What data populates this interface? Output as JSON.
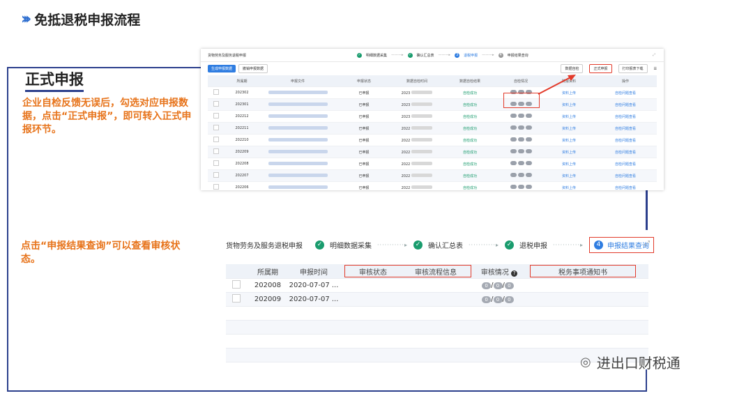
{
  "header": {
    "title": "免抵退税申报流程"
  },
  "section": {
    "title": "正式申报"
  },
  "notes": {
    "note1": "企业自检反馈无误后，勾选对应申报数据，点击“正式申报”，即可转入正式申报环节。",
    "note2": "点击“申报结果查询”可以查看审核状态。"
  },
  "shot1": {
    "crumb": "货物劳务及服务退税申报",
    "steps": [
      "明细数据采集",
      "确认汇总表",
      "退税申报",
      "申报结果查询"
    ],
    "toolbar": {
      "generate": "生成申报数据",
      "withdraw": "撤销申报数据",
      "selfcheck": "数据自检",
      "formal": "正式申报",
      "print": "打印报表下载"
    },
    "headers": [
      "所属期",
      "申报文件",
      "申报状态",
      "数据自检时间",
      "数据自检结果",
      "自检情况",
      "随报资料",
      "操作"
    ],
    "rows": [
      {
        "period": "202302",
        "status": "已申报",
        "time": "2023",
        "result": "自检成功",
        "upload": "资料上传",
        "op": "自检问题查看"
      },
      {
        "period": "202301",
        "status": "已申报",
        "time": "2023",
        "result": "自检成功",
        "upload": "资料上传",
        "op": "自检问题查看"
      },
      {
        "period": "202212",
        "status": "已申报",
        "time": "2023",
        "result": "自检成功",
        "upload": "资料上传",
        "op": "自检问题查看"
      },
      {
        "period": "202211",
        "status": "已申报",
        "time": "2022",
        "result": "自检成功",
        "upload": "资料上传",
        "op": "自检问题查看"
      },
      {
        "period": "202210",
        "status": "已申报",
        "time": "2022",
        "result": "自检成功",
        "upload": "资料上传",
        "op": "自检问题查看"
      },
      {
        "period": "202209",
        "status": "已申报",
        "time": "2022",
        "result": "自检成功",
        "upload": "资料上传",
        "op": "自检问题查看"
      },
      {
        "period": "202208",
        "status": "已申报",
        "time": "2022",
        "result": "自检成功",
        "upload": "资料上传",
        "op": "自检问题查看"
      },
      {
        "period": "202207",
        "status": "已申报",
        "time": "2022",
        "result": "自检成功",
        "upload": "资料上传",
        "op": "自检问题查看"
      },
      {
        "period": "202206",
        "status": "已申报",
        "time": "2022",
        "result": "自检成功",
        "upload": "资料上传",
        "op": "自检问题查看"
      }
    ]
  },
  "shot2": {
    "crumb": "货物劳务及服务退税申报",
    "steps": [
      "明细数据采集",
      "确认汇总表",
      "退税申报",
      "申报结果查询"
    ],
    "current_step_num": "4",
    "headers": [
      "所属期",
      "申报时间",
      "审核状态",
      "审核流程信息",
      "审核情况",
      "税务事项通知书"
    ],
    "rows": [
      {
        "period": "202008",
        "time": "2020-07-07 ..."
      },
      {
        "period": "202009",
        "time": "2020-07-07 ..."
      }
    ]
  },
  "watermark": {
    "text": "进出口财税通"
  }
}
